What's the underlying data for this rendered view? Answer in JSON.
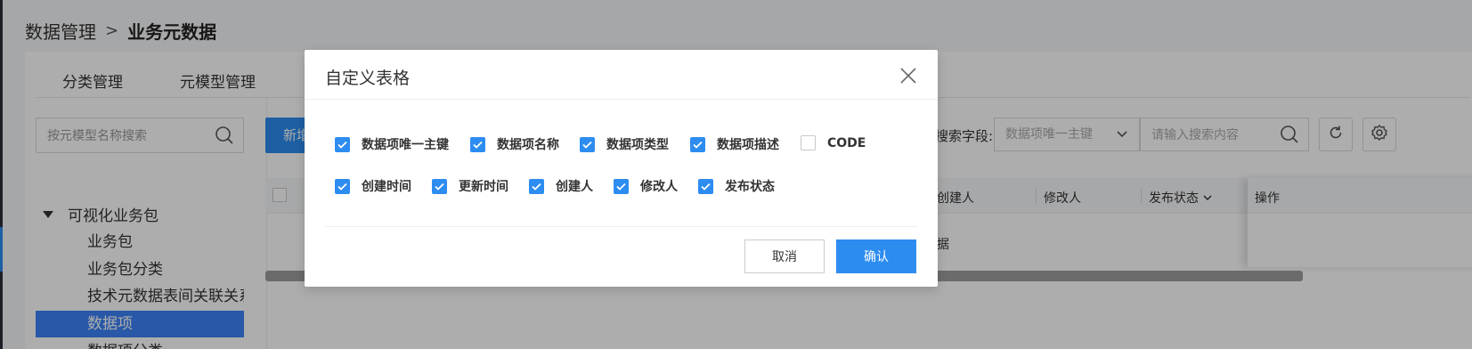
{
  "breadcrumb": {
    "parent": "数据管理",
    "separator": ">",
    "current": "业务元数据"
  },
  "tabs": [
    {
      "label": "分类管理"
    },
    {
      "label": "元模型管理"
    }
  ],
  "tree": {
    "search_placeholder": "按元模型名称搜索",
    "root": "可视化业务包",
    "items": [
      {
        "label": "业务包"
      },
      {
        "label": "业务包分类"
      },
      {
        "label": "技术元数据表间关联关系"
      },
      {
        "label": "数据项",
        "selected": true
      },
      {
        "label": "数据项分类"
      }
    ]
  },
  "toolbar": {
    "new_label": "新增",
    "search_field_label": "搜索字段:",
    "search_field_value": "数据项唯一主键",
    "search_placeholder": "请输入搜索内容"
  },
  "table": {
    "headers": {
      "creator": "创建人",
      "modifier": "修改人",
      "publish_status": "发布状态",
      "actions": "操作"
    },
    "row_partial": "据"
  },
  "modal": {
    "title": "自定义表格",
    "options": [
      {
        "label": "数据项唯一主键",
        "checked": true
      },
      {
        "label": "数据项名称",
        "checked": true
      },
      {
        "label": "数据项类型",
        "checked": true
      },
      {
        "label": "数据项描述",
        "checked": true
      },
      {
        "label": "CODE",
        "checked": false
      },
      {
        "label": "创建时间",
        "checked": true
      },
      {
        "label": "更新时间",
        "checked": true
      },
      {
        "label": "创建人",
        "checked": true
      },
      {
        "label": "修改人",
        "checked": true
      },
      {
        "label": "发布状态",
        "checked": true
      }
    ],
    "cancel_label": "取消",
    "confirm_label": "确认"
  },
  "colors": {
    "primary": "#2d8cf0",
    "selected_item": "#3b82f6",
    "overlay": "rgba(0,0,0,0.32)"
  }
}
